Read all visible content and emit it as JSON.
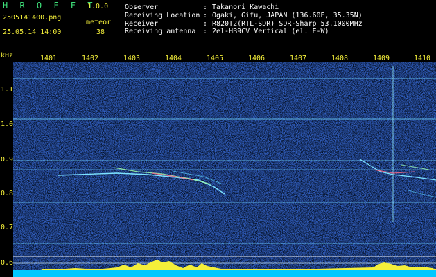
{
  "app": {
    "title": "H R O F F T",
    "version": "1.0.0",
    "filename": "2505141400.png",
    "datetime": "25.05.14 14:00",
    "meteor_label": "meteor",
    "meteor_count": "38"
  },
  "info": {
    "rows": [
      {
        "label": "Observer",
        "value": "Takanori Kawachi"
      },
      {
        "label": "Receiving Location",
        "value": "Ogaki, Gifu, JAPAN (136.60E, 35.35N)"
      },
      {
        "label": "Receiver",
        "value": "R820T2(RTL-SDR) SDR-Sharp 53.1000MHz"
      },
      {
        "label": "Receiving antenna",
        "value": "2el-HB9CV Vertical (el. E-W)"
      }
    ],
    "separator": ":"
  },
  "axes": {
    "y_unit": "kHz",
    "x_ticks": [
      "1401",
      "1402",
      "1403",
      "1404",
      "1405",
      "1406",
      "1407",
      "1408",
      "1409",
      "1410"
    ],
    "y_ticks": [
      "1.1",
      "1.0",
      "0.9",
      "0.8",
      "0.7",
      "0.6"
    ]
  },
  "colors": {
    "background": "#000000",
    "label_yellow": "#f4ef3a",
    "title_green": "#3ee07a",
    "noise_blue": "#1a3cc0",
    "trace_cyan": "#7de3ff"
  }
}
